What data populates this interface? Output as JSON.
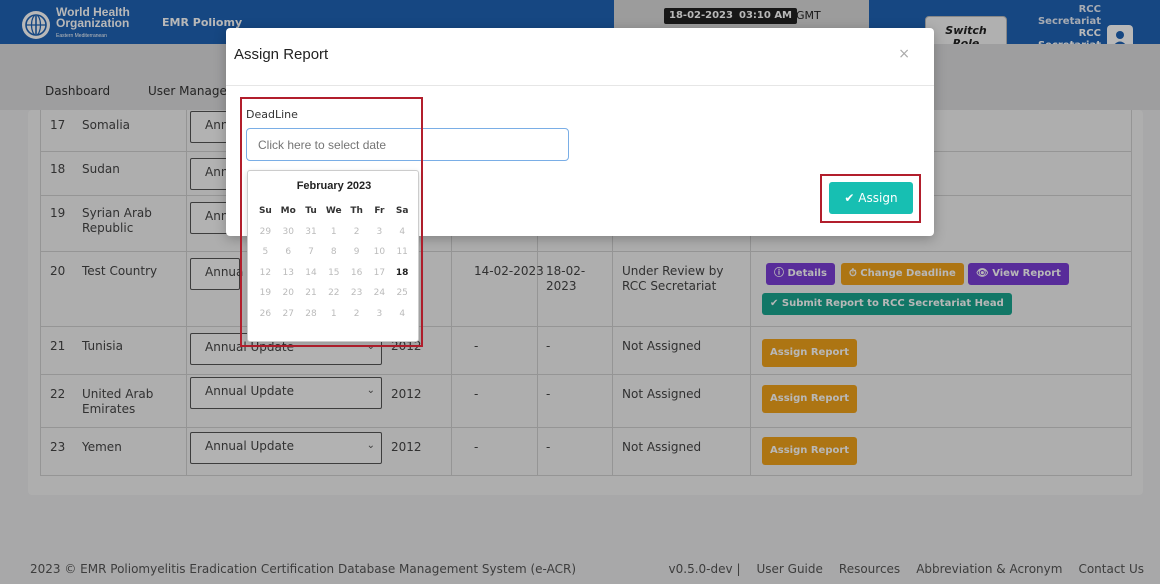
{
  "header": {
    "org_line1": "World Health",
    "org_line2": "Organization",
    "org_line3": "Eastern Mediterranean",
    "app_short": "EMR Poliomy",
    "date": "18-02-2023",
    "time": "03:10 AM",
    "timezone": "GMT",
    "switch_role_1": "Switch",
    "switch_role_2": "Role",
    "role_line1": "RCC",
    "role_line2": "Secretariat",
    "role_line3": "RCC",
    "role_line4": "Secretariat",
    "colors": {
      "header_bg": "#1f63b5",
      "accent_teal": "#17bfb2",
      "orange": "#f0a21b",
      "purple": "#7a3ed6"
    }
  },
  "nav": {
    "dashboard": "Dashboard",
    "user_management": "User Manage"
  },
  "rows": [
    {
      "no": "17",
      "country": "Somalia",
      "report_type": "Annu"
    },
    {
      "no": "18",
      "country": "Sudan",
      "report_type": "Ann"
    },
    {
      "no": "19",
      "country": "Syrian Arab Republic",
      "report_type": "Ann"
    },
    {
      "no": "20",
      "country": "Test Country",
      "report_type": "Annua",
      "assigned": "14-02-2023",
      "deadline": "18-02-2023",
      "status": "Under Review by RCC Secretariat",
      "actions": {
        "details": "Details",
        "change_deadline": "Change Deadline",
        "view_report": "View Report",
        "submit": "Submit Report to RCC Secretariat Head"
      }
    },
    {
      "no": "21",
      "country": "Tunisia",
      "report_type": "Annual Update",
      "year": "2012",
      "assigned": "-",
      "deadline": "-",
      "status": "Not Assigned",
      "action": "Assign Report"
    },
    {
      "no": "22",
      "country": "United Arab Emirates",
      "report_type": "Annual Update",
      "year": "2012",
      "assigned": "-",
      "deadline": "-",
      "status": "Not Assigned",
      "action": "Assign Report"
    },
    {
      "no": "23",
      "country": "Yemen",
      "report_type": "Annual Update",
      "year": "2012",
      "assigned": "-",
      "deadline": "-",
      "status": "Not Assigned",
      "action": "Assign Report"
    }
  ],
  "footer": {
    "copyright": "2023 © EMR Poliomyelitis Eradication Certification Database Management System (e-ACR)",
    "version": "v0.5.0-dev",
    "sep": "|",
    "user_guide": "User Guide",
    "resources": "Resources",
    "abbreviation": "Abbreviation & Acronym",
    "contact": "Contact Us"
  },
  "modal": {
    "title": "Assign Report",
    "close": "×",
    "deadline_label": "DeadLine",
    "date_placeholder": "Click here to select date",
    "assign_label": "Assign"
  },
  "calendar": {
    "month": "February 2023",
    "weekdays": [
      "Su",
      "Mo",
      "Tu",
      "We",
      "Th",
      "Fr",
      "Sa"
    ],
    "weeks": [
      [
        "29",
        "30",
        "31",
        "1",
        "2",
        "3",
        "4"
      ],
      [
        "5",
        "6",
        "7",
        "8",
        "9",
        "10",
        "11"
      ],
      [
        "12",
        "13",
        "14",
        "15",
        "16",
        "17",
        "18"
      ],
      [
        "19",
        "20",
        "21",
        "22",
        "23",
        "24",
        "25"
      ],
      [
        "26",
        "27",
        "28",
        "1",
        "2",
        "3",
        "4"
      ]
    ],
    "today": "18"
  }
}
